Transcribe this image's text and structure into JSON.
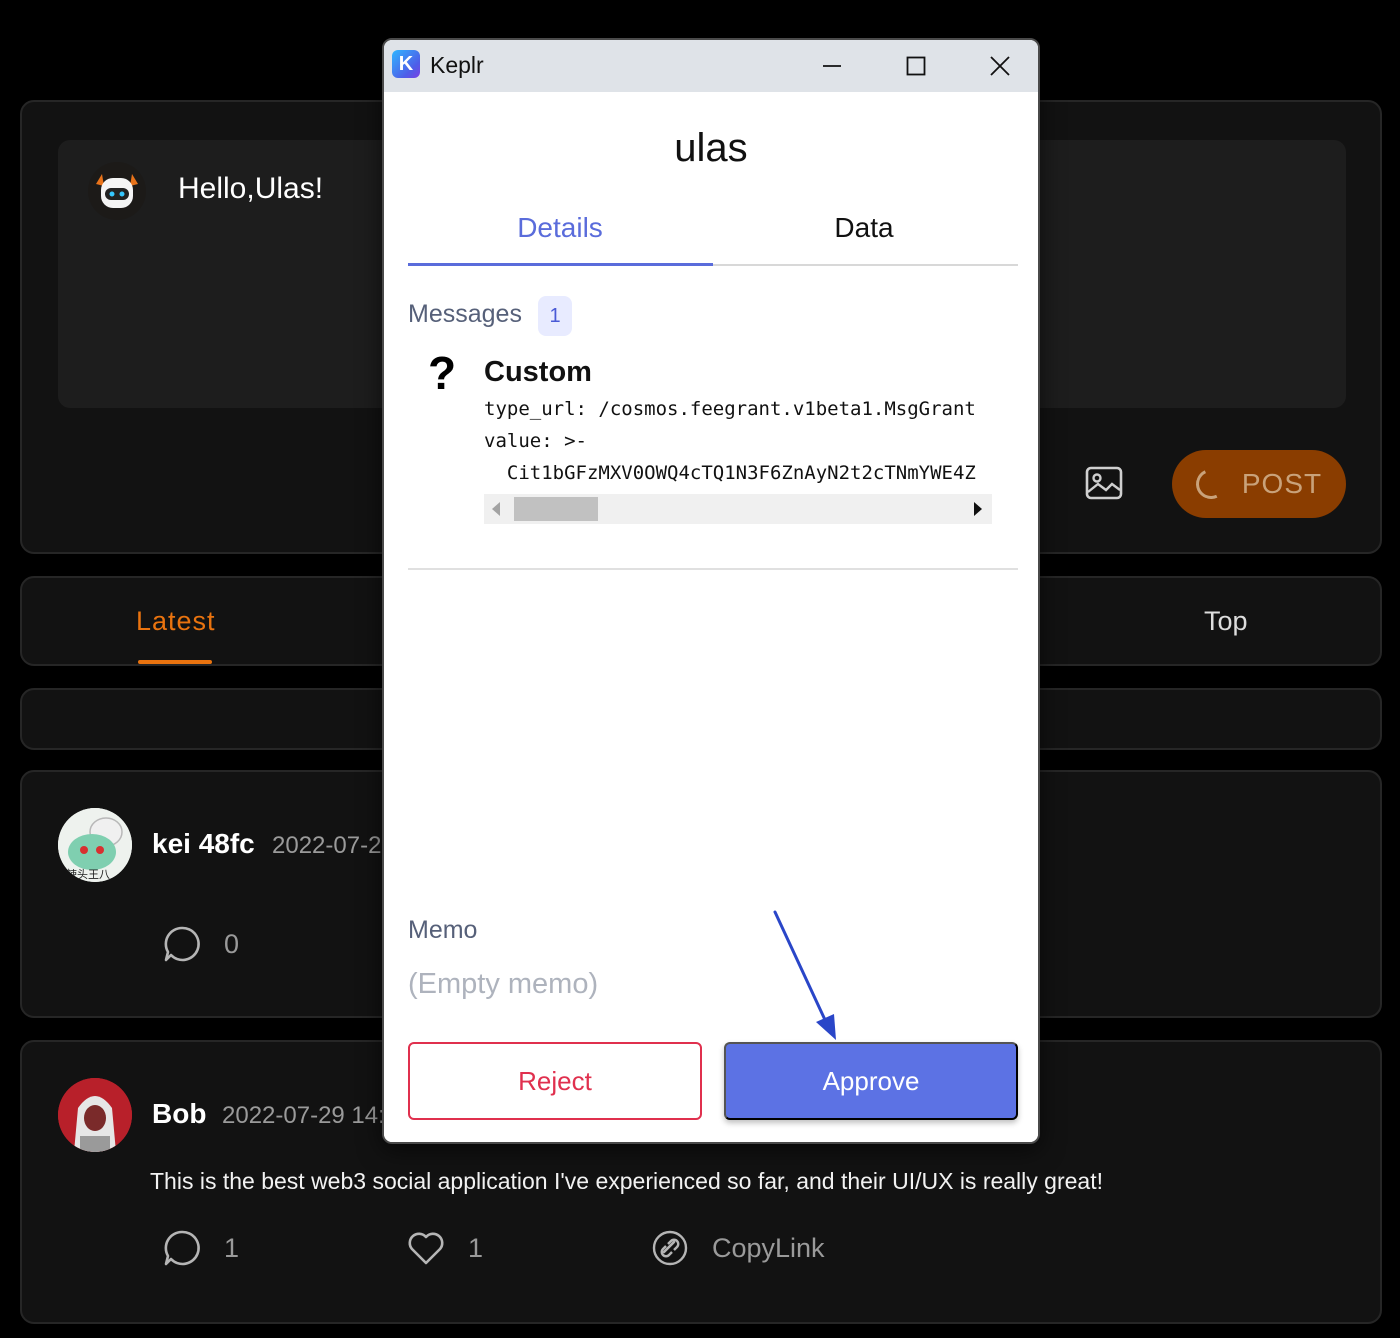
{
  "app": {
    "greeting": "Hello,Ulas!",
    "post_button": "POST",
    "feed_tabs": {
      "latest": "Latest",
      "top": "Top"
    },
    "posts": [
      {
        "user": "kei 48fc",
        "date": "2022-07-2",
        "comments": "0",
        "avatar_caption": "辣头王八"
      },
      {
        "user": "Bob",
        "date": "2022-07-29 14:",
        "text": "This is the best web3 social application I've experienced so far, and their UI/UX is really great!",
        "comments": "1",
        "likes": "1",
        "copy_link": "CopyLink"
      }
    ]
  },
  "keplr": {
    "window_title": "Keplr",
    "logo_letter": "K",
    "chain_name": "ulas",
    "tabs": {
      "details": "Details",
      "data": "Data",
      "active": "details"
    },
    "messages_label": "Messages",
    "messages_count": "1",
    "message": {
      "icon": "question-mark-icon",
      "title": "Custom",
      "type_url_line": "type_url: /cosmos.feegrant.v1beta1.MsgGrant",
      "value_line": "value: >-",
      "value_data": "  Cit1bGFzMXV0OWQ4cTQ1N3F6ZnAyN2t2cTNmYWE4Z"
    },
    "memo_label": "Memo",
    "memo_value": "(Empty memo)",
    "reject_label": "Reject",
    "approve_label": "Approve"
  },
  "colors": {
    "accent_orange": "#e9730f",
    "keplr_blue": "#5c72e4",
    "reject_red": "#e0304e",
    "callout_arrow": "#2a46c8"
  }
}
